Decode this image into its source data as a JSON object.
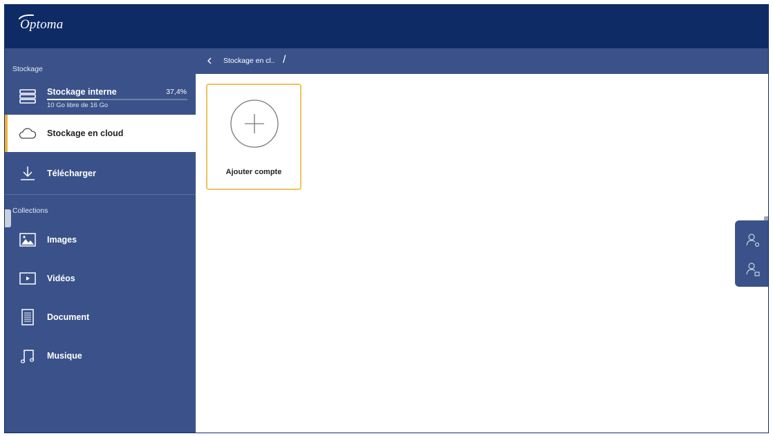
{
  "app": {
    "brand": "Optoma"
  },
  "sidebar": {
    "storage_section": "Stockage",
    "internal_storage": {
      "title": "Stockage interne",
      "percent_label": "37,4%",
      "used_fraction": 0.374,
      "subtitle": "10 Go libre de 16 Go",
      "icon": "server-icon"
    },
    "items": [
      {
        "label": "Stockage en cloud",
        "icon": "cloud-icon",
        "active": true
      },
      {
        "label": "Télécharger",
        "icon": "download-icon",
        "active": false
      }
    ],
    "collections_section": "Collections",
    "collections": [
      {
        "label": "Images",
        "icon": "image-icon"
      },
      {
        "label": "Vidéos",
        "icon": "video-icon"
      },
      {
        "label": "Document",
        "icon": "document-icon"
      },
      {
        "label": "Musique",
        "icon": "music-icon"
      }
    ]
  },
  "content": {
    "breadcrumb": "Stockage en cl..",
    "breadcrumb_separator": "/",
    "add_account_label": "Ajouter compte"
  },
  "colors": {
    "header": "#0f2b66",
    "sidebar": "#3a5289",
    "accent": "#f0b23a",
    "card_border": "#f0c35a"
  }
}
